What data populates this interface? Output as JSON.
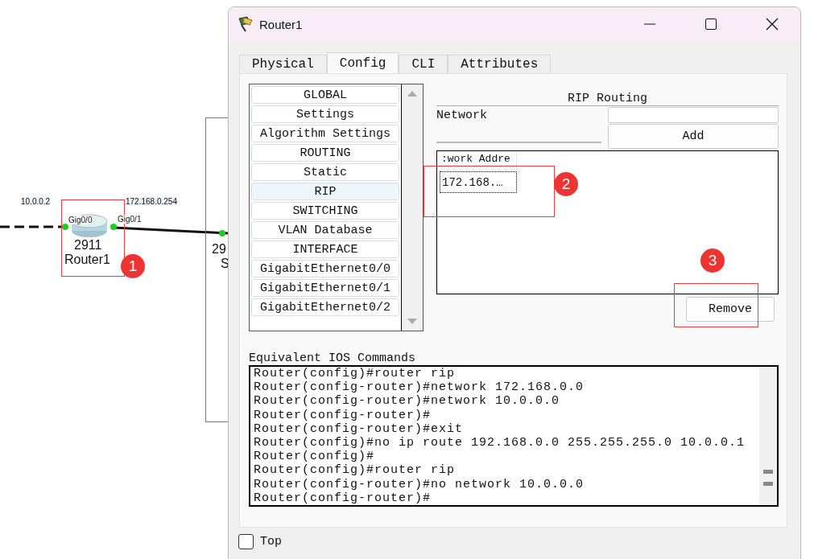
{
  "canvas": {
    "link_labels": [
      "10.0.0.2",
      "172.168.0.254"
    ],
    "router": {
      "ports": [
        "Gig0/0",
        "Gig0/1"
      ],
      "model": "2911",
      "name": "Router1"
    },
    "switch": {
      "model": "29",
      "name": "S"
    }
  },
  "annotations": [
    {
      "number": "1"
    },
    {
      "number": "2"
    },
    {
      "number": "3"
    }
  ],
  "window": {
    "title": "Router1",
    "tabs": [
      {
        "label": "Physical",
        "selected": false
      },
      {
        "label": "Config",
        "selected": true
      },
      {
        "label": "CLI",
        "selected": false
      },
      {
        "label": "Attributes",
        "selected": false
      }
    ],
    "config_menu": [
      {
        "label": "GLOBAL",
        "selected": false
      },
      {
        "label": "Settings",
        "selected": false
      },
      {
        "label": "Algorithm Settings",
        "selected": false
      },
      {
        "label": "ROUTING",
        "selected": false
      },
      {
        "label": "Static",
        "selected": false
      },
      {
        "label": "RIP",
        "selected": true
      },
      {
        "label": "SWITCHING",
        "selected": false
      },
      {
        "label": "VLAN Database",
        "selected": false
      },
      {
        "label": "INTERFACE",
        "selected": false
      },
      {
        "label": "GigabitEthernet0/0",
        "selected": false
      },
      {
        "label": "GigabitEthernet0/1",
        "selected": false
      },
      {
        "label": "GigabitEthernet0/2",
        "selected": false
      }
    ],
    "rip": {
      "title": "RIP Routing",
      "network_label": "Network",
      "add_button": "Add",
      "column_header": ":work Addre",
      "rows": [
        {
          "value": "172.168.…",
          "selected": true
        }
      ],
      "remove_button": "Remove"
    },
    "ios_title": "Equivalent IOS Commands",
    "ios_lines": [
      "Router(config)#router rip",
      "Router(config-router)#network 172.168.0.0",
      "Router(config-router)#network 10.0.0.0",
      "Router(config-router)#",
      "Router(config-router)#exit",
      "Router(config)#no ip route 192.168.0.0 255.255.255.0 10.0.0.1",
      "Router(config)#",
      "Router(config)#router rip",
      "Router(config-router)#no network 10.0.0.0",
      "Router(config-router)#"
    ],
    "top": {
      "label": "Top",
      "checked": false
    }
  }
}
